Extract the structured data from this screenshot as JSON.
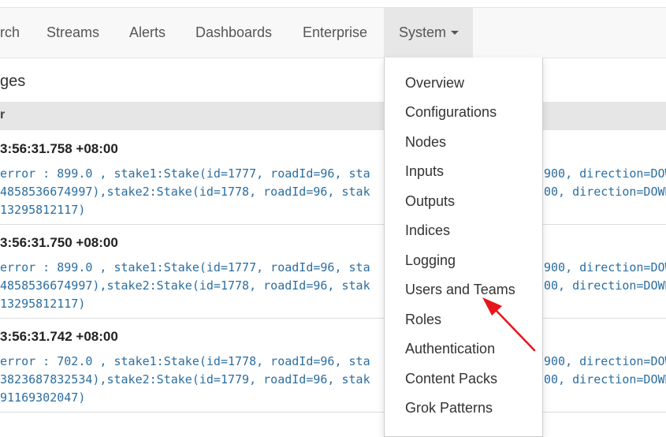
{
  "navbar": {
    "items": [
      {
        "label": "rch"
      },
      {
        "label": "Streams"
      },
      {
        "label": "Alerts"
      },
      {
        "label": "Dashboards"
      },
      {
        "label": "Enterprise"
      },
      {
        "label": "System",
        "active": true
      }
    ]
  },
  "page": {
    "heading": "ges",
    "table_header": "r"
  },
  "messages": [
    {
      "timestamp": "3:56:31.758 +08:00",
      "lines": [
        "error : 899.0 , stake1:Stake(id=1777, roadId=96, sta",
        "4858536674997),stake2:Stake(id=1778, roadId=96, stak",
        "13295812117)"
      ],
      "lines_right": [
        "900, direction=DOW",
        "00, direction=DOWN"
      ]
    },
    {
      "timestamp": "3:56:31.750 +08:00",
      "lines": [
        "error : 899.0 , stake1:Stake(id=1777, roadId=96, sta",
        "4858536674997),stake2:Stake(id=1778, roadId=96, stak",
        "13295812117)"
      ],
      "lines_right": [
        "900, direction=DOW",
        "00, direction=DOWN"
      ]
    },
    {
      "timestamp": "3:56:31.742 +08:00",
      "lines": [
        "error : 702.0 , stake1:Stake(id=1778, roadId=96, sta",
        "3823687832534),stake2:Stake(id=1779, roadId=96, stak",
        "91169302047)"
      ],
      "lines_right": [
        "900, direction=DOW",
        "00, direction=DOWN"
      ]
    }
  ],
  "dropdown": {
    "items": [
      "Overview",
      "Configurations",
      "Nodes",
      "Inputs",
      "Outputs",
      "Indices",
      "Logging",
      "Users and Teams",
      "Roles",
      "Authentication",
      "Content Packs",
      "Grok Patterns"
    ]
  },
  "annotation": {
    "arrow_color": "#e8141c"
  },
  "colors": {
    "navbar_bg": "#f8f8f8",
    "active_bg": "#e7e7e7",
    "message_text": "#2c6ea0"
  }
}
